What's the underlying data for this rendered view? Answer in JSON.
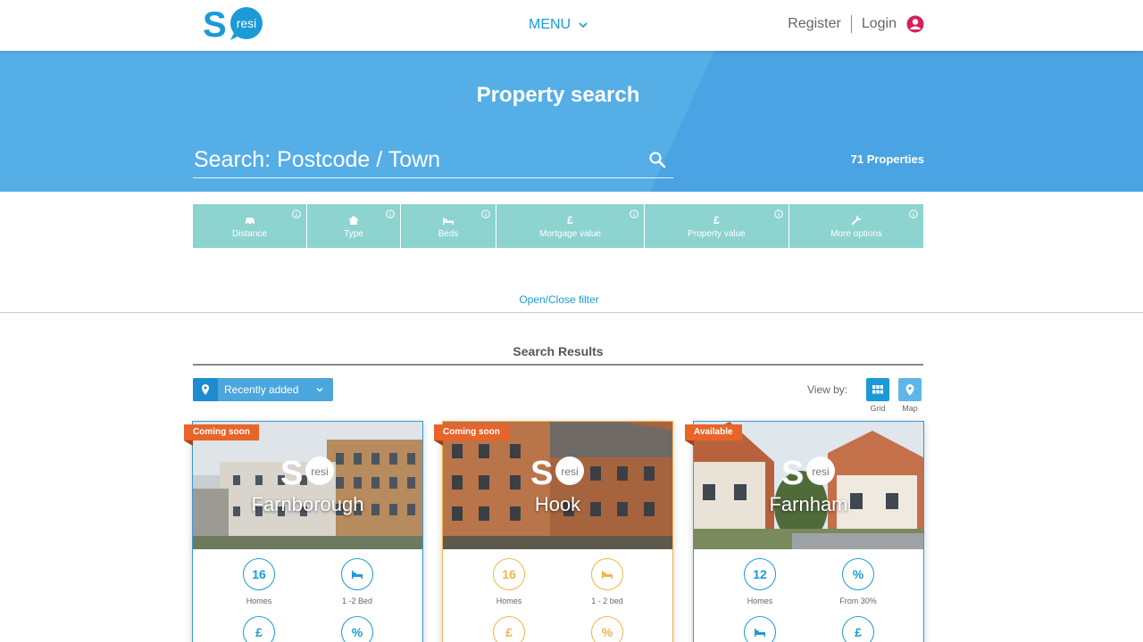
{
  "header": {
    "menu_label": "MENU",
    "register_label": "Register",
    "login_label": "Login"
  },
  "hero": {
    "title": "Property search",
    "search_placeholder": "Search: Postcode / Town",
    "property_count": "71 Properties"
  },
  "filters": [
    {
      "label": "Distance",
      "icon": "car-icon"
    },
    {
      "label": "Type",
      "icon": "house-icon"
    },
    {
      "label": "Beds",
      "icon": "bed-icon"
    },
    {
      "label": "Mortgage value",
      "icon": "pound-icon"
    },
    {
      "label": "Property value",
      "icon": "pound-icon"
    },
    {
      "label": "More options",
      "icon": "wrench-icon"
    }
  ],
  "filter_toggle": "Open/Close filter",
  "results": {
    "title": "Search Results",
    "sort_label": "Recently added",
    "view_by_label": "View by:",
    "grid_label": "Grid",
    "map_label": "Map"
  },
  "cards": [
    {
      "badge": "Coming soon",
      "place": "Farnborough",
      "stats": [
        {
          "value": "16",
          "caption": "Homes"
        },
        {
          "icon": "bed-icon",
          "caption": "1 -2 Bed"
        },
        {
          "icon": "pound-icon",
          "value": "£"
        },
        {
          "icon": "percent-icon",
          "value": "%"
        }
      ]
    },
    {
      "badge": "Coming soon",
      "place": "Hook",
      "stats": [
        {
          "value": "16",
          "caption": "Homes"
        },
        {
          "icon": "bed-icon",
          "caption": "1 - 2 bed"
        },
        {
          "icon": "pound-icon",
          "value": "£"
        },
        {
          "icon": "percent-icon",
          "value": "%"
        }
      ]
    },
    {
      "badge": "Available",
      "place": "Farnham",
      "stats": [
        {
          "value": "12",
          "caption": "Homes"
        },
        {
          "value": "%",
          "caption": "From 30%"
        },
        {
          "icon": "bed-icon"
        },
        {
          "icon": "pound-icon",
          "value": "£"
        }
      ]
    }
  ],
  "colors": {
    "brand_blue": "#1a9ad6",
    "hero_blue": "#55aee6",
    "filter_teal": "#8dd3cf",
    "badge_orange": "#e8642a",
    "accent_orange": "#f0b54c",
    "login_pink": "#d6215b"
  }
}
